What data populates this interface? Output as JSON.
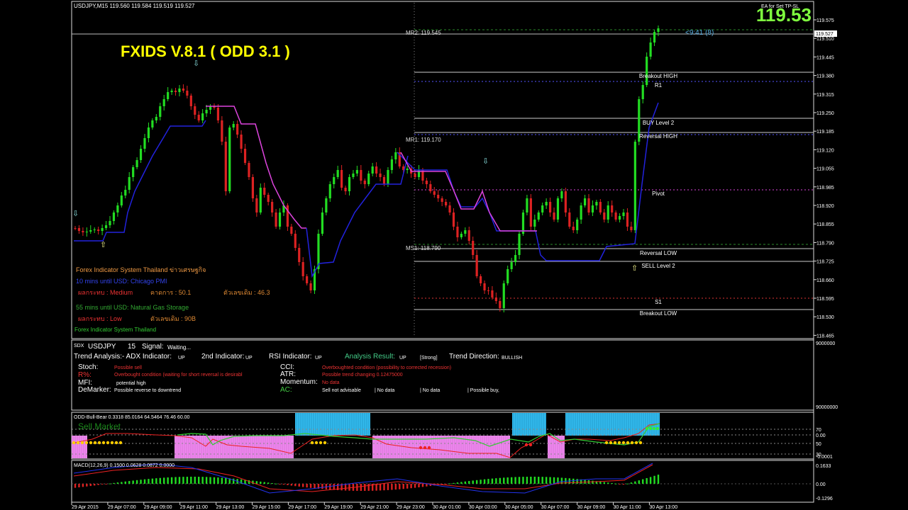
{
  "window": {
    "symbol_bar": "USDJPY,M15  119.560 119.584 119.519 119.527",
    "ea_label": "EA for Set TP-SL",
    "big_price": "119.53",
    "timer": "<9:41 (8)"
  },
  "main": {
    "title": "FXIDS V.8.1   ( ODD 3.1 )",
    "levels": {
      "mr2": "MR2: 119.545",
      "mr1": "MR1: 119.170",
      "ms1": "MS1: 118.790",
      "breakout_high": "Breakout HIGH",
      "r1": "R1",
      "buy_level2": "BUY Level 2",
      "reversal_high": "Reversal HIGH",
      "pivot": "Pivot",
      "reversal_low": "Reversal LOW",
      "sell_level2": "SELL Level 2",
      "s1": "S1",
      "breakout_low": "Breakout LOW"
    },
    "info": {
      "system_name": "Forex  Indicator System Thailand ข่าวเศรษฐกิจ",
      "news1": "10 mins until USD: Chicago PMI",
      "news1_impact": "ผลกระทบ : Medium",
      "news1_forecast": "คาดการ : 50.1",
      "news1_previous": "ตัวเลขเดิม : 46.3",
      "news2": "55 mins until USD: Natural Gas Storage",
      "news2_impact": "ผลกระทบ : Low",
      "news2_previous": "ตัวเลขเดิม : 90B",
      "footer": "Forex  Indicator System Thailand"
    },
    "price_scale": [
      "119.575",
      "119.510",
      "119.445",
      "119.380",
      "119.315",
      "119.250",
      "119.185",
      "119.120",
      "119.055",
      "118.985",
      "118.920",
      "118.855",
      "118.790",
      "118.725",
      "118.660",
      "118.595",
      "118.530",
      "118.465"
    ],
    "current_price_tag": "119.527"
  },
  "sdx": {
    "label": "SDX",
    "pair": "USDJPY",
    "tf": "15",
    "signal_label": "Signal:",
    "signal_value": "Waiting...",
    "scale_top": "9000000",
    "scale_bottom": "90000000",
    "trend_analysis": "Trend Analysis:-  ADX Indicator:",
    "adx_val": "UP",
    "second_ind": "2nd Indicator:",
    "second_val": "UP",
    "rsi_ind": "RSI Indicator:",
    "rsi_val": "UP",
    "analysis_result": "Analysis Result:",
    "analysis_val": "UP",
    "strong": "[Strong]",
    "trend_direction": "Trend Direction:",
    "trend_val": "BULLISH",
    "stoch_k": "Stoch:",
    "stoch_v": "Possible sell",
    "r_k": "R%:",
    "r_v": "Overbought condition (waiting for short reversal is desirabl",
    "mfi_k": "MFI:",
    "mfi_v": "potential high",
    "dem_k": "DeMarker:",
    "dem_v": "Possible reverse to downtrend",
    "cci_k": "CCI:",
    "cci_v": "Overboughted condition (possibility to corrected recession)",
    "atr_k": "ATR:",
    "atr_v": "Possible trend changing 0.12475000",
    "mom_k": "Momentum:",
    "mom_v": "No data",
    "ac_k": "AC:",
    "ac_v1": "Sell not advisable",
    "ac_v2": "| No data",
    "ac_v3": "| No data",
    "ac_v4": "| Possible buy,"
  },
  "odd": {
    "label": "ODD-Bull-Bear 0.3318 85.0164 64.5464 76.46 60.00",
    "overlay": "Sell Market",
    "scale": [
      "70",
      "0.00",
      "50",
      "30",
      "-0.0001"
    ]
  },
  "macd": {
    "label": "MACD(12,26,9) 0.1500 0.0628 0.0872 0.0000",
    "scale": [
      "0.1633",
      "0.00",
      "-0.1296"
    ]
  },
  "time_axis": [
    "29 Apr 2015",
    "29 Apr 07:00",
    "29 Apr 09:00",
    "29 Apr 11:00",
    "29 Apr 13:00",
    "29 Apr 15:00",
    "29 Apr 17:00",
    "29 Apr 19:00",
    "29 Apr 21:00",
    "29 Apr 23:00",
    "30 Apr 01:00",
    "30 Apr 03:00",
    "30 Apr 05:00",
    "30 Apr 07:00",
    "30 Apr 09:00",
    "30 Apr 11:00",
    "30 Apr 13:00"
  ],
  "colors": {
    "bull": "#22dd22",
    "bear": "#dd2222",
    "magenta": "#dd44dd",
    "blue": "#2222dd",
    "yellow": "#ffff00",
    "cyan": "#33bbee",
    "pink": "#ee88ee"
  }
}
